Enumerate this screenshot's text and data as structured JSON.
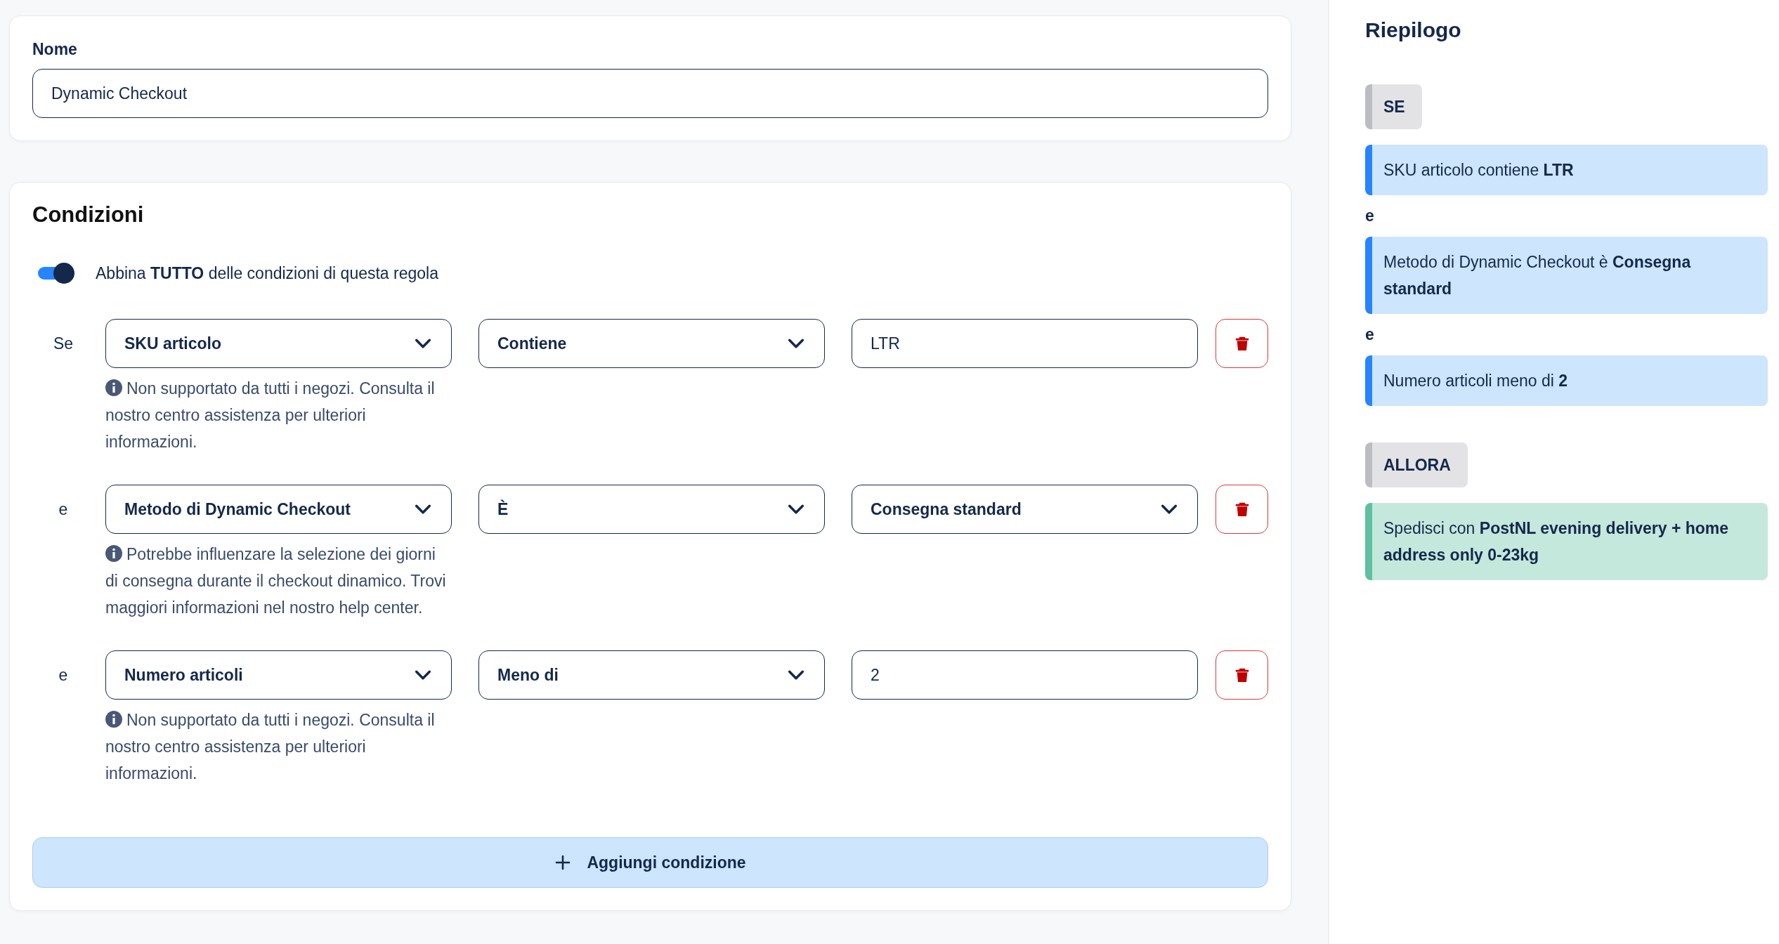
{
  "name_field": {
    "label": "Nome",
    "value": "Dynamic Checkout"
  },
  "conditions": {
    "title": "Condizioni",
    "match_all": {
      "on": true,
      "label": "Abbina **TUTTO** delle condizioni di questa regola"
    },
    "rows": [
      {
        "connector": "Se",
        "field": "SKU articolo",
        "operator": "Contiene",
        "value": {
          "kind": "input",
          "text": "LTR"
        },
        "note": "Non supportato da tutti i negozi. Consulta il nostro centro assistenza per ulteriori informazioni."
      },
      {
        "connector": "e",
        "field": "Metodo di Dynamic Checkout",
        "operator": "È",
        "value": {
          "kind": "select",
          "text": "Consegna standard"
        },
        "note": "Potrebbe influenzare la selezione dei giorni di consegna durante il checkout dinamico. Trovi maggiori informazioni nel nostro help center."
      },
      {
        "connector": "e",
        "field": "Numero articoli",
        "operator": "Meno di",
        "value": {
          "kind": "input",
          "text": "2"
        },
        "note": "Non supportato da tutti i negozi. Consulta il nostro centro assistenza per ulteriori informazioni."
      }
    ],
    "add_button": "Aggiungi condizione"
  },
  "summary": {
    "title": "Riepilogo",
    "if_tag": "SE",
    "conditions": [
      {
        "text": "SKU articolo contiene **LTR**"
      },
      {
        "connector": "e",
        "text": "Metodo di Dynamic Checkout è **Consegna standard**"
      },
      {
        "connector": "e",
        "text": "Numero articoli meno di **2**"
      }
    ],
    "then_tag": "ALLORA",
    "action": "Spedisci con **PostNL evening delivery + home address only 0-23kg**"
  }
}
